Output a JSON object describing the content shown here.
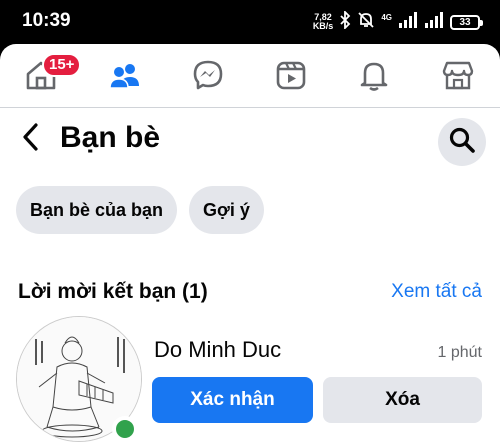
{
  "status_bar": {
    "time": "10:39",
    "net_speed_value": "7,82",
    "net_speed_unit": "KB/s",
    "network_type": "4G",
    "battery": "33"
  },
  "tabs": [
    {
      "name": "home",
      "badge": "15+"
    },
    {
      "name": "friends",
      "active": true
    },
    {
      "name": "messenger"
    },
    {
      "name": "watch"
    },
    {
      "name": "notifications"
    },
    {
      "name": "marketplace"
    }
  ],
  "header": {
    "title": "Bạn bè"
  },
  "chips": {
    "your_friends": "Bạn bè của bạn",
    "suggestions": "Gợi ý"
  },
  "requests_section": {
    "title": "Lời mời kết bạn (1)",
    "see_all": "Xem tất cả"
  },
  "request": {
    "name": "Do Minh Duc",
    "time": "1 phút",
    "confirm_label": "Xác nhận",
    "delete_label": "Xóa"
  },
  "colors": {
    "accent": "#1877f2",
    "badge": "#e41e3f",
    "online": "#31a24c",
    "chip_bg": "#e4e6eb"
  }
}
